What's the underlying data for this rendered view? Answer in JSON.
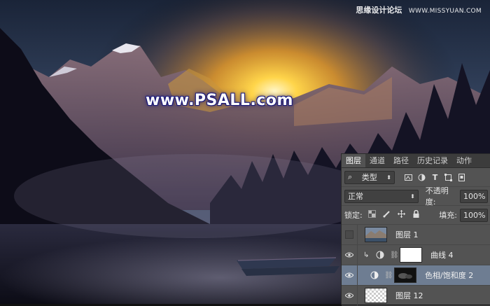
{
  "watermark": {
    "logo_text": "www.PSALL.com",
    "site_cn": "思缘设计论坛",
    "site_url": "WWW.MISSYUAN.COM"
  },
  "layers_panel": {
    "tabs": [
      {
        "label": "图层",
        "active": true
      },
      {
        "label": "通道",
        "active": false
      },
      {
        "label": "路径",
        "active": false
      },
      {
        "label": "历史记录",
        "active": false
      },
      {
        "label": "动作",
        "active": false
      }
    ],
    "filter": {
      "kind_label": "类型",
      "search_icon": "search-icon",
      "dropdown_icon": "up-down-arrows-icon"
    },
    "blend_mode": "正常",
    "opacity_label": "不透明度:",
    "opacity_value": "100%",
    "lock_label": "锁定:",
    "fill_label": "填充:",
    "fill_value": "100%",
    "layers": [
      {
        "name": "图层 1",
        "visible": false,
        "type": "pixel",
        "selected": false
      },
      {
        "name": "曲线 4",
        "visible": true,
        "type": "curves-adjustment",
        "clipped": true,
        "selected": false
      },
      {
        "name": "色相/饱和度 2",
        "visible": true,
        "type": "hue-saturation-adjustment",
        "selected": true
      },
      {
        "name": "图层 12",
        "visible": true,
        "type": "pixel-transparent",
        "selected": false
      }
    ],
    "colors": {
      "panel_bg": "#535353",
      "selected_row": "#6e7d92",
      "tab_bar": "#3c3c3c"
    }
  }
}
